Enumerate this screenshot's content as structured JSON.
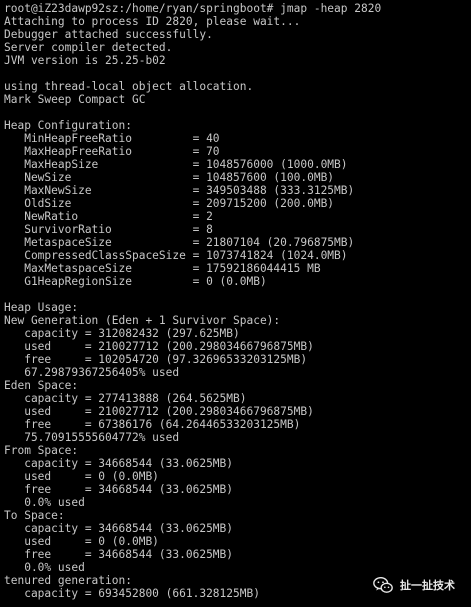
{
  "terminal": {
    "lines": [
      "root@iZ23dawp92sz:/home/ryan/springboot# jmap -heap 2820",
      "Attaching to process ID 2820, please wait...",
      "Debugger attached successfully.",
      "Server compiler detected.",
      "JVM version is 25.25-b02",
      "",
      "using thread-local object allocation.",
      "Mark Sweep Compact GC",
      "",
      "Heap Configuration:",
      "   MinHeapFreeRatio         = 40",
      "   MaxHeapFreeRatio         = 70",
      "   MaxHeapSize              = 1048576000 (1000.0MB)",
      "   NewSize                  = 104857600 (100.0MB)",
      "   MaxNewSize               = 349503488 (333.3125MB)",
      "   OldSize                  = 209715200 (200.0MB)",
      "   NewRatio                 = 2",
      "   SurvivorRatio            = 8",
      "   MetaspaceSize            = 21807104 (20.796875MB)",
      "   CompressedClassSpaceSize = 1073741824 (1024.0MB)",
      "   MaxMetaspaceSize         = 17592186044415 MB",
      "   G1HeapRegionSize         = 0 (0.0MB)",
      "",
      "Heap Usage:",
      "New Generation (Eden + 1 Survivor Space):",
      "   capacity = 312082432 (297.625MB)",
      "   used     = 210027712 (200.29803466796875MB)",
      "   free     = 102054720 (97.32696533203125MB)",
      "   67.29879367256405% used",
      "Eden Space:",
      "   capacity = 277413888 (264.5625MB)",
      "   used     = 210027712 (200.29803466796875MB)",
      "   free     = 67386176 (64.26446533203125MB)",
      "   75.70915555604772% used",
      "From Space:",
      "   capacity = 34668544 (33.0625MB)",
      "   used     = 0 (0.0MB)",
      "   free     = 34668544 (33.0625MB)",
      "   0.0% used",
      "To Space:",
      "   capacity = 34668544 (33.0625MB)",
      "   used     = 0 (0.0MB)",
      "   free     = 34668544 (33.0625MB)",
      "   0.0% used",
      "tenured generation:",
      "   capacity = 693452800 (661.328125MB)"
    ]
  },
  "watermark": {
    "text": "扯一扯技术",
    "icon": "wechat-icon"
  },
  "colors": {
    "background": "#000000",
    "text": "#c7c7c7"
  }
}
